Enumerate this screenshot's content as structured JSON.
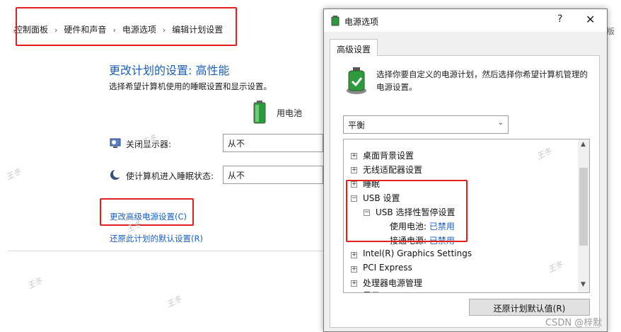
{
  "breadcrumb": {
    "items": [
      "控制面板",
      "硬件和声音",
      "电源选项",
      "编辑计划设置"
    ],
    "separator": "›"
  },
  "right_fragment": "版",
  "plan": {
    "title": "更改计划的设置: 高性能",
    "subtitle": "选择希望计算机使用的睡眠设置和显示设置。",
    "battery_label": "用电池",
    "display_off": {
      "label": "关闭显示器:",
      "value": "从不"
    },
    "sleep": {
      "label": "使计算机进入睡眠状态:",
      "value": "从不"
    },
    "advanced_link": "更改高级电源设置(C)",
    "restore_link": "还原此计划的默认设置(R)"
  },
  "dialog": {
    "title": "电源选项",
    "help": "?",
    "close": "✕",
    "tab": "高级设置",
    "description": "选择你要自定义的电源计划，然后选择你希望计算机管理的电源设置。",
    "plan_select": "平衡",
    "tree": {
      "items": [
        {
          "label": "桌面背景设置",
          "expander": "+"
        },
        {
          "label": "无线适配器设置",
          "expander": "+"
        },
        {
          "label": "睡眠",
          "expander": "+"
        },
        {
          "label": "USB 设置",
          "expander": "−"
        },
        {
          "label": "USB 选择性暂停设置",
          "expander": "−"
        },
        {
          "label": "使用电池:",
          "value": "已禁用"
        },
        {
          "label": "接通电源:",
          "value": "已禁用"
        },
        {
          "label": "Intel(R) Graphics Settings",
          "expander": "+"
        },
        {
          "label": "PCI Express",
          "expander": "+"
        },
        {
          "label": "处理器电源管理",
          "expander": "+"
        },
        {
          "label": "显示",
          "expander": "+"
        }
      ]
    },
    "restore_button": "还原计划默认值(R)"
  },
  "watermarks": [
    "王冬",
    "王冬",
    "王冬",
    "王冬",
    "王冬",
    "王冬",
    "王冬"
  ],
  "csdn": "CSDN @梓默",
  "colors": {
    "highlight_box": "#e02020",
    "link_blue": "#1a5fbf",
    "title_blue": "#1d5fb3"
  }
}
